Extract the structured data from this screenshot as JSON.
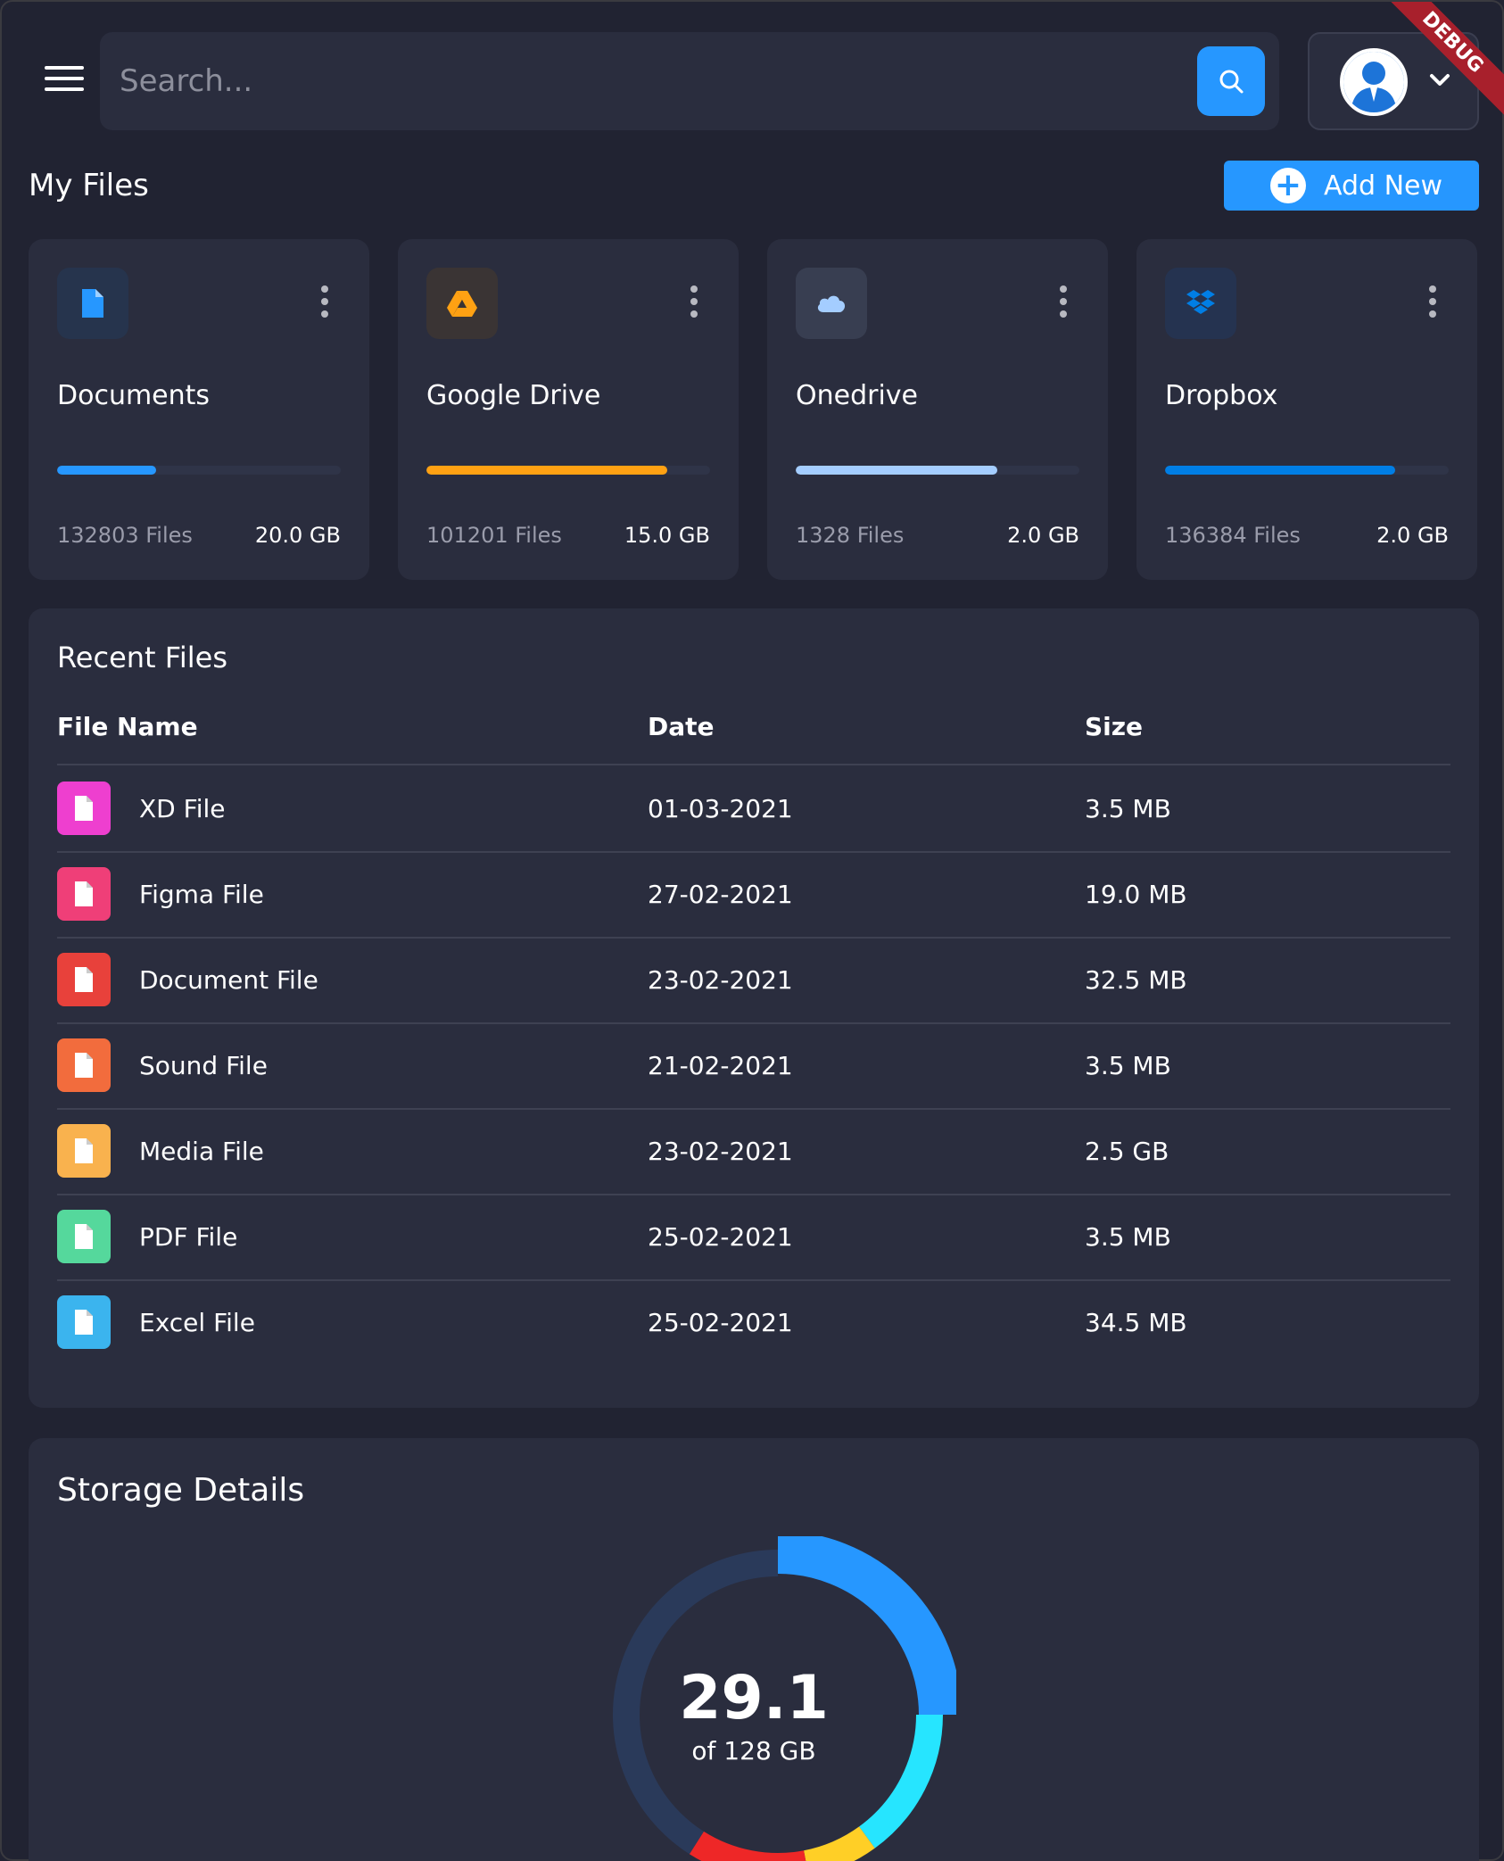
{
  "header": {
    "search_placeholder": "Search...",
    "search_icon": "search-icon",
    "menu_icon": "hamburger-menu-icon",
    "profile_icon": "user-avatar",
    "debug_label": "DEBUG"
  },
  "my_files": {
    "title": "My Files",
    "add_button_label": "Add New",
    "cards": [
      {
        "name": "Documents",
        "files": "132803 Files",
        "size": "20.0 GB",
        "usage": 0.35,
        "icon": "document-icon",
        "color": "#2697ff",
        "icon_bg": "#26344d"
      },
      {
        "name": "Google Drive",
        "files": "101201 Files",
        "size": "15.0 GB",
        "usage": 0.85,
        "icon": "google-drive-icon",
        "color": "#ffa113",
        "icon_bg": "#3a3434"
      },
      {
        "name": "Onedrive",
        "files": "1328 Files",
        "size": "2.0 GB",
        "usage": 0.71,
        "icon": "cloud-icon",
        "color": "#a4cdff",
        "icon_bg": "#383e51"
      },
      {
        "name": "Dropbox",
        "files": "136384 Files",
        "size": "2.0 GB",
        "usage": 0.81,
        "icon": "dropbox-icon",
        "color": "#007ee5",
        "icon_bg": "#253350"
      }
    ]
  },
  "recent_files": {
    "title": "Recent Files",
    "columns": [
      "File Name",
      "Date",
      "Size"
    ],
    "rows": [
      {
        "name": "XD File",
        "date": "01-03-2021",
        "size": "3.5 MB",
        "icon": "xd-file-icon",
        "color": "#ee3fcf"
      },
      {
        "name": "Figma File",
        "date": "27-02-2021",
        "size": "19.0 MB",
        "icon": "figma-icon",
        "color": "#ef3f78"
      },
      {
        "name": "Document File",
        "date": "23-02-2021",
        "size": "32.5 MB",
        "icon": "document-icon",
        "color": "#e8413b"
      },
      {
        "name": "Sound File",
        "date": "21-02-2021",
        "size": "3.5 MB",
        "icon": "sound-file-icon",
        "color": "#f26c3d"
      },
      {
        "name": "Media File",
        "date": "23-02-2021",
        "size": "2.5 GB",
        "icon": "media-file-icon",
        "color": "#f9b24e"
      },
      {
        "name": "PDF File",
        "date": "25-02-2021",
        "size": "3.5 MB",
        "icon": "pdf-icon",
        "color": "#55d89c"
      },
      {
        "name": "Excel File",
        "date": "25-02-2021",
        "size": "34.5 MB",
        "icon": "excel-icon",
        "color": "#3bb4ee"
      }
    ]
  },
  "storage": {
    "title": "Storage Details",
    "used": "29.1",
    "total_label": "of 128 GB",
    "segments": [
      {
        "color": "#2697ff",
        "fraction": 0.25
      },
      {
        "color": "#26e5ff",
        "fraction": 0.15
      },
      {
        "color": "#ffcf26",
        "fraction": 0.07
      },
      {
        "color": "#ee2727",
        "fraction": 0.12
      },
      {
        "color": "#2a3a5a",
        "fraction": 0.41
      }
    ]
  }
}
